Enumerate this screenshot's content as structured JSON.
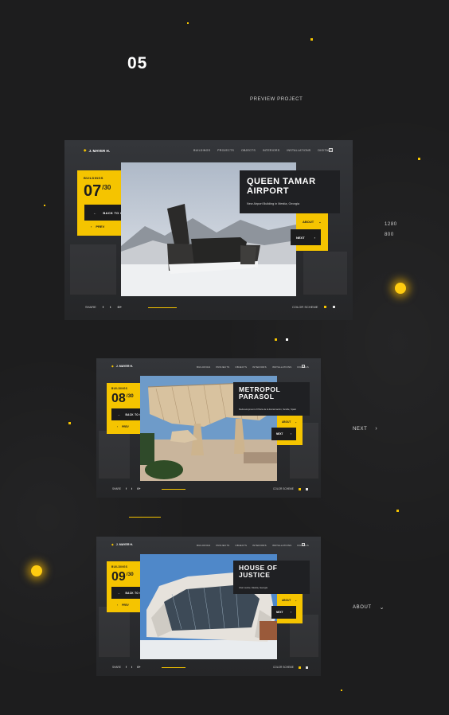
{
  "page": {
    "number": "05",
    "preview_label": "PREVIEW PROJECT",
    "resolution_width": "1280",
    "resolution_height": "800",
    "side_next_label": "NEXT",
    "side_about_label": "ABOUT",
    "accent_color": "#f5c400"
  },
  "nav": {
    "logo": "J. MAYER H.",
    "items": [
      "BUILDINGS",
      "PROJECTS",
      "OBJECTS",
      "INTERIORS",
      "INSTALLATIONS",
      "DIGITALS"
    ]
  },
  "cards": [
    {
      "category": "BUILDINGS",
      "number": "07",
      "total": "/30",
      "back_label": "BACK TO GRID",
      "prev_label": "PREV",
      "title_line1": "QUEEN TAMAR",
      "title_line2": "AIRPORT",
      "subtitle": "New Airport Building in Mestia, Georgia",
      "about_label": "ABOUT",
      "next_label": "NEXT",
      "share_label": "SHARE",
      "share_icons": [
        "f",
        "t",
        "G+"
      ],
      "scheme_label": "COLOR SCHEME"
    },
    {
      "category": "BUILDINGS",
      "number": "08",
      "total": "/30",
      "back_label": "BACK TO GRID",
      "prev_label": "PREV",
      "title_line1": "METROPOL",
      "title_line2": "PARASOL",
      "subtitle": "Redevelopment of Plaza de la Encarnación, Seville, Spain",
      "about_label": "ABOUT",
      "next_label": "NEXT",
      "share_label": "SHARE",
      "share_icons": [
        "f",
        "t",
        "G+"
      ],
      "scheme_label": "COLOR SCHEME"
    },
    {
      "category": "BUILDINGS",
      "number": "09",
      "total": "/30",
      "back_label": "BACK TO GRID",
      "prev_label": "PREV",
      "title_line1": "HOUSE OF",
      "title_line2": "JUSTICE",
      "subtitle": "Civic centre, Mestia, Georgia",
      "about_label": "ABOUT",
      "next_label": "NEXT",
      "share_label": "SHARE",
      "share_icons": [
        "f",
        "t",
        "G+"
      ],
      "scheme_label": "COLOR SCHEME"
    }
  ]
}
